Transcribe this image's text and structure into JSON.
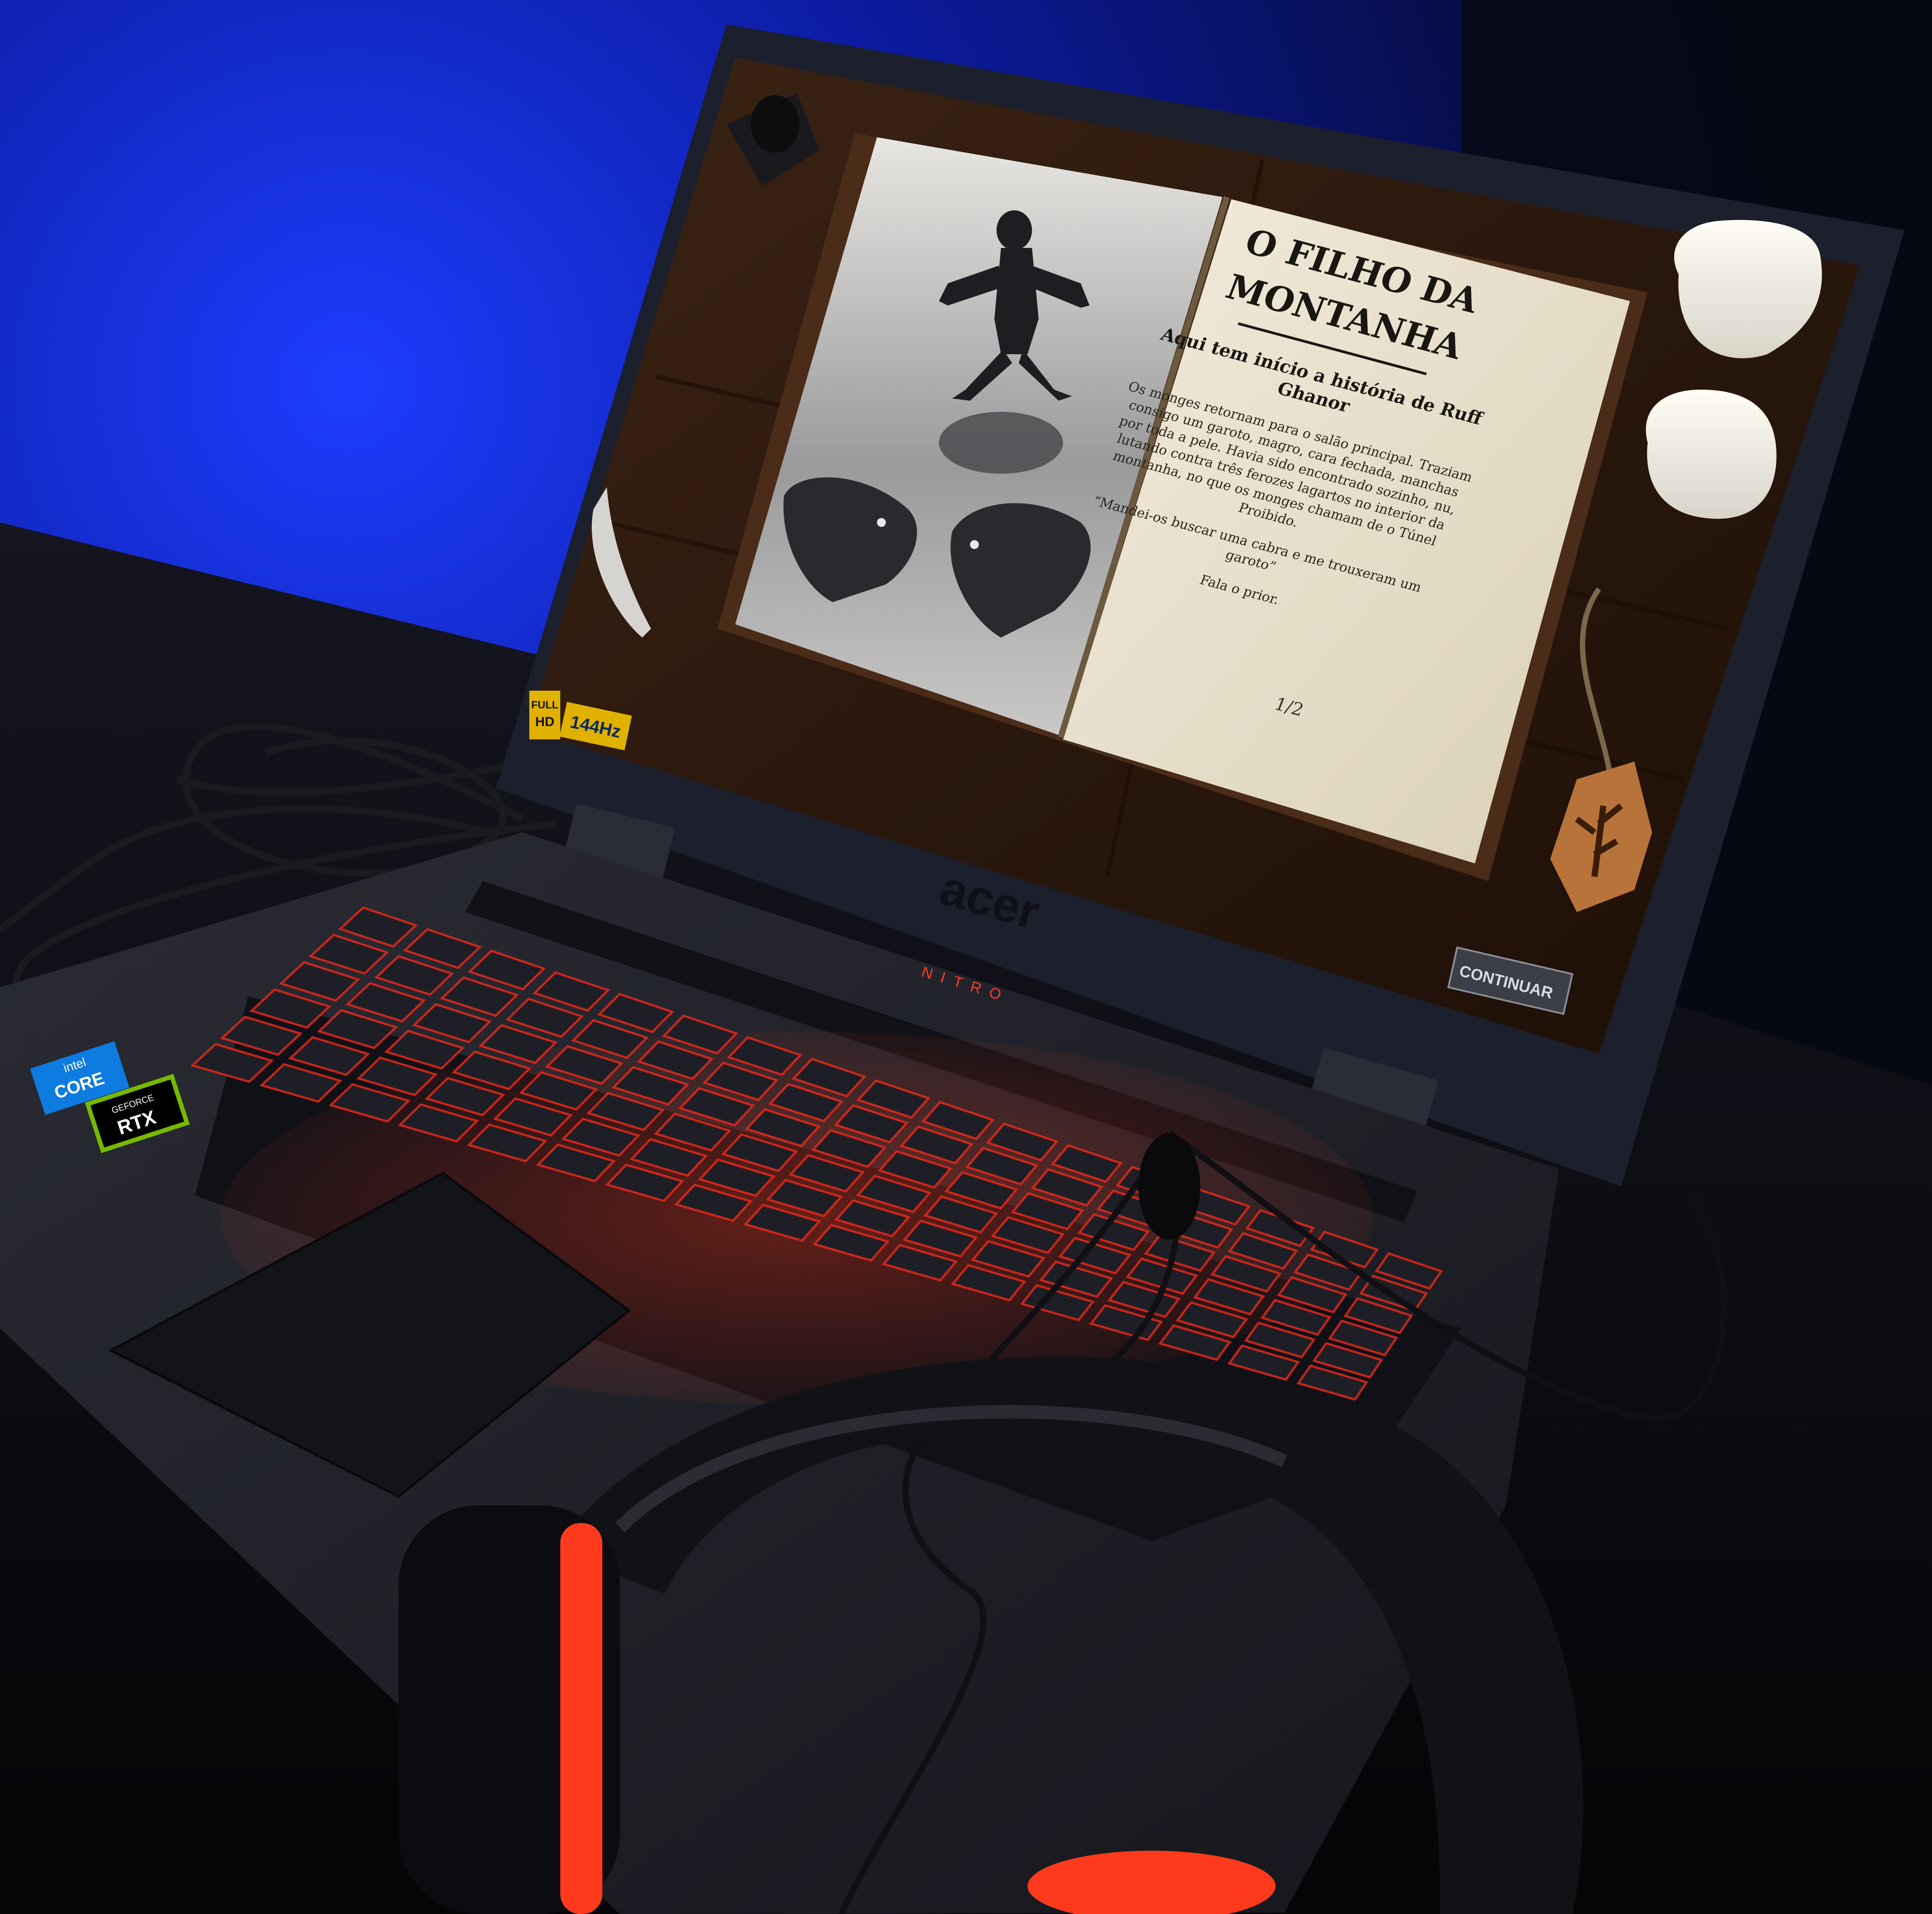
{
  "photo": {
    "brand_logo": "acer",
    "lid_text": "NITRO",
    "refresh_badge": "144Hz",
    "fhd_badge_top": "FULL",
    "fhd_badge_bottom": "HD",
    "sticker_intel_brand": "intel",
    "sticker_intel_product": "CORE",
    "sticker_nvidia_brand": "GEFORCE",
    "sticker_nvidia_product": "RTX",
    "accent_color": "#ff2a1a",
    "background_color": "#0a1fae"
  },
  "game": {
    "title_line1": "O FILHO DA",
    "title_line2": "MONTANHA",
    "subtitle_line1": "Aqui tem início a história de Ruff",
    "subtitle_line2": "Ghanor",
    "body_lines": [
      "Os monges retornam para o salão principal. Traziam",
      "consigo um garoto, magro, cara fechada, manchas",
      "por toda a pele. Havia sido encontrado sozinho, nu,",
      "lutando contra três ferozes lagartos no interior da",
      "montanha, no que os monges chamam de o Túnel",
      "Proibido."
    ],
    "quote_line1": "“Mandei-os buscar uma cabra e me trouxeram um",
    "quote_line2": "garoto”",
    "attribution": "Fala o prior.",
    "page_indicator": "1/2",
    "continue_button": "CONTINUAR"
  }
}
